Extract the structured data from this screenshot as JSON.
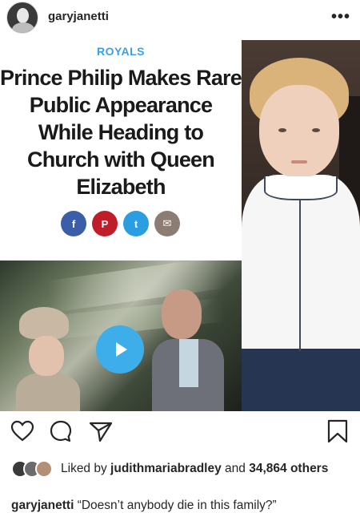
{
  "post": {
    "username": "garyjanetti",
    "more_label": "•••"
  },
  "article": {
    "category": "ROYALS",
    "headline": "Prince Philip Makes Rare Public Appearance While Heading to Church with Queen Elizabeth",
    "share_buttons": [
      {
        "icon": "facebook-icon",
        "glyph": "f"
      },
      {
        "icon": "pinterest-icon",
        "glyph": "P"
      },
      {
        "icon": "twitter-icon",
        "glyph": "t"
      },
      {
        "icon": "mail-icon",
        "glyph": "✉"
      }
    ]
  },
  "actions": {
    "icons": [
      "heart-icon",
      "comment-icon",
      "share-icon",
      "save-icon"
    ]
  },
  "likes": {
    "prefix": "Liked by",
    "liker": "judithmariabradley",
    "middle": "and",
    "count": "34,864",
    "suffix": "others"
  },
  "caption": {
    "username": "garyjanetti",
    "text": "“Doesn’t anybody die in this family?”"
  },
  "colors": {
    "accent_blue": "#3aa0e6",
    "facebook": "#3a5fa8",
    "pinterest": "#c01d2a",
    "twitter": "#2a9ee0",
    "mail": "#8b7c74",
    "play_button": "#3daee9"
  }
}
